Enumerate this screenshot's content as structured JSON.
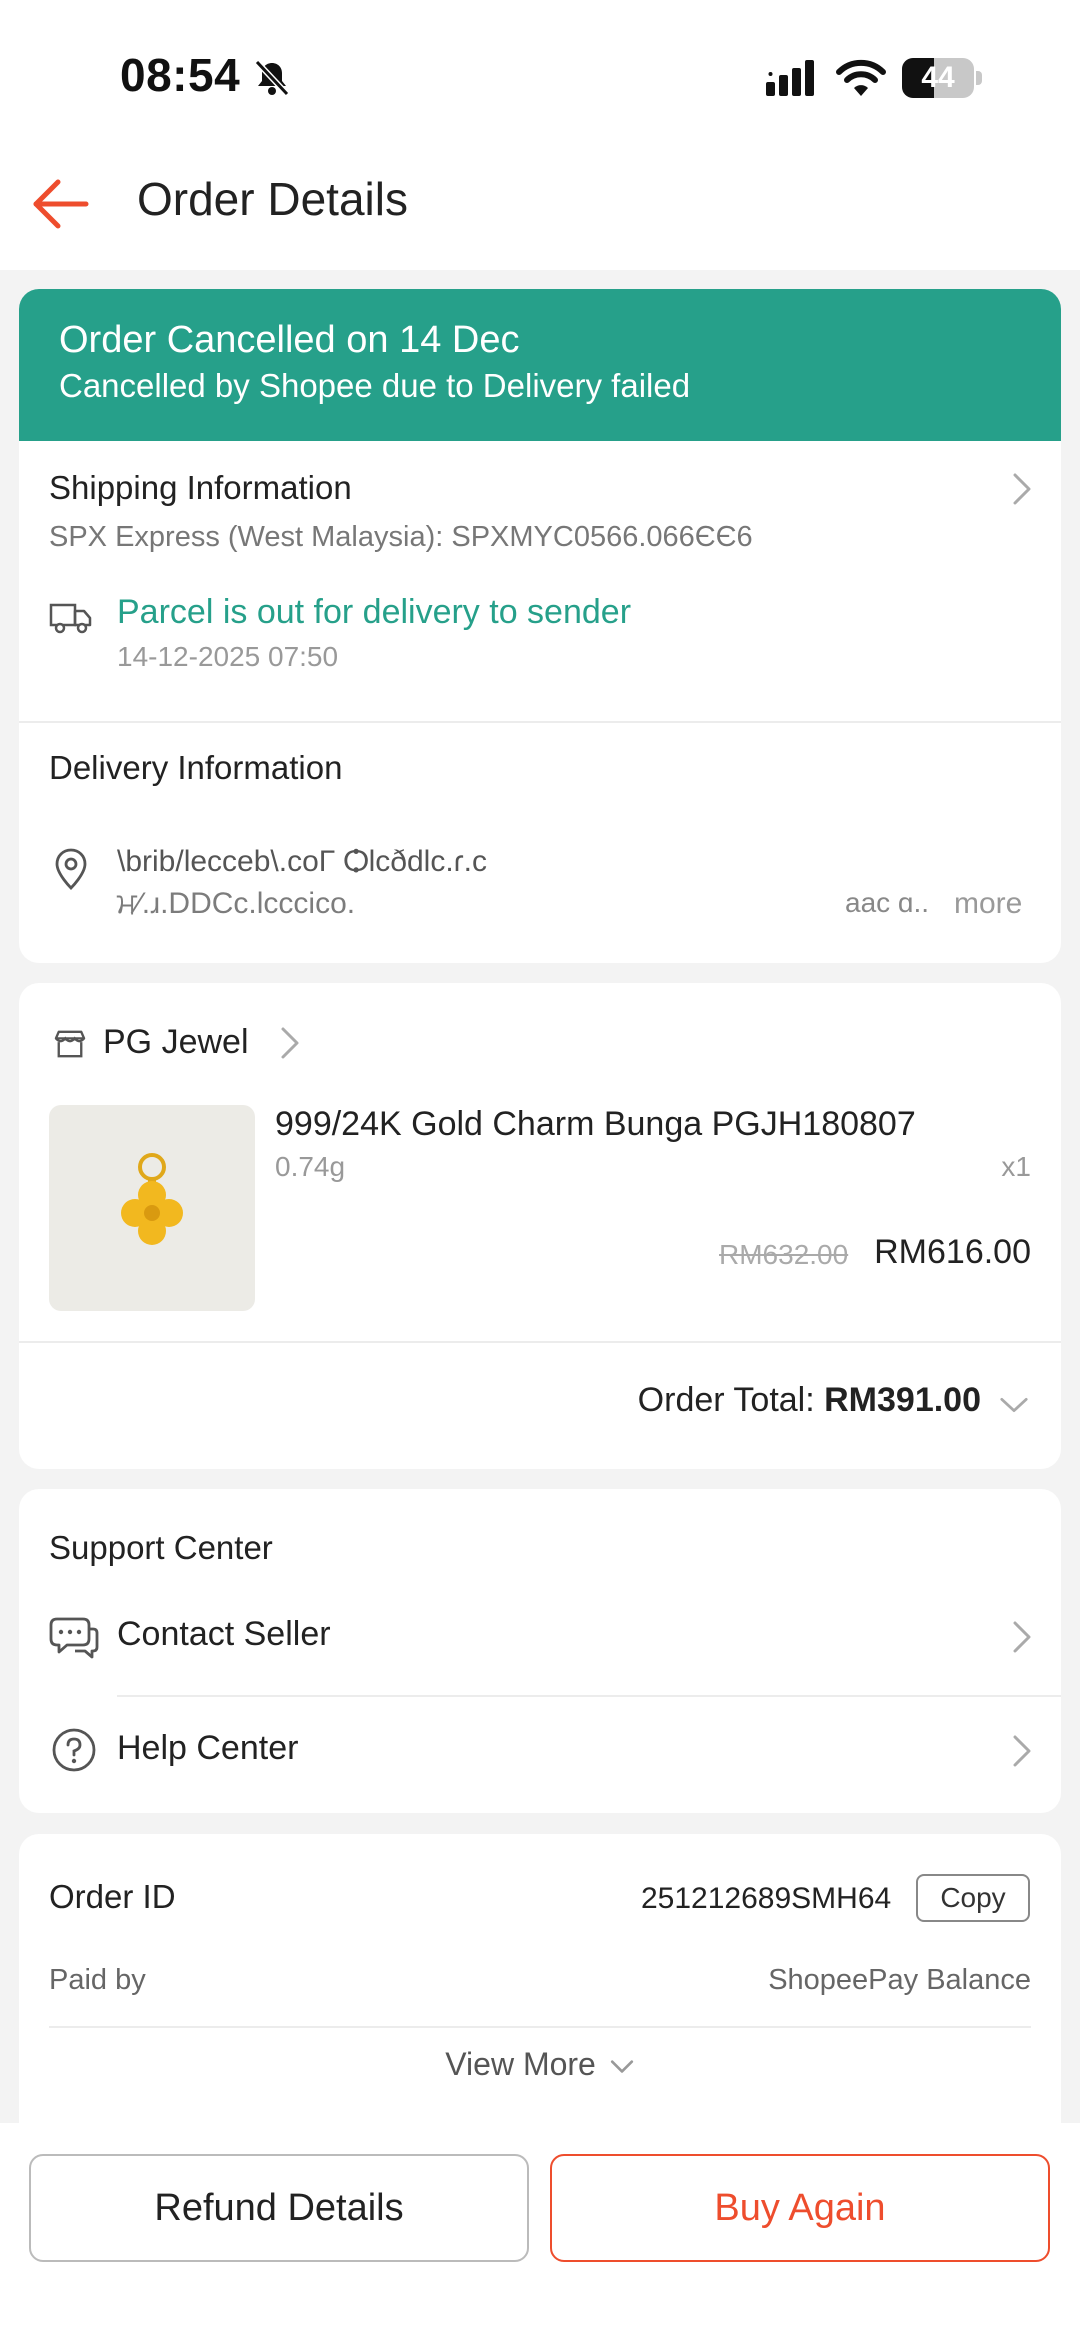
{
  "status_bar": {
    "time": "08:54",
    "battery": "44",
    "battery_level": 0.44
  },
  "header": {
    "title": "Order Details"
  },
  "banner": {
    "title": "Order Cancelled on 14 Dec",
    "subtitle": "Cancelled by Shopee due to Delivery failed",
    "color": "#26a08a"
  },
  "shipping": {
    "title": "Shipping Information",
    "carrier": "SPX Express (West Malaysia): SPXMYC0566.066ЄЄ6",
    "status": "Parcel is out for delivery to sender",
    "timestamp": "14-12-2025 07:50"
  },
  "delivery": {
    "title": "Delivery Information",
    "address_line1": "\\brib/lecceb\\.coΓ Ѻlcðdlc.ɾ.c",
    "address_line2": "ਮ⁄.ɹ.DDCc.lcccico.",
    "address_line3": "aac ɑ..",
    "more": "more"
  },
  "shop": {
    "name": "PG Jewel",
    "product": {
      "name": "999/24K Gold Charm Bunga PGJH180807",
      "variation": "0.74g",
      "quantity": "x1",
      "original_price": "RM632.00",
      "price": "RM616.00"
    },
    "order_total_label": "Order Total: ",
    "order_total": "RM391.00"
  },
  "support": {
    "title": "Support Center",
    "contact_seller": "Contact Seller",
    "help_center": "Help Center"
  },
  "order_info": {
    "order_id_label": "Order ID",
    "order_id": "251212689SMH64",
    "copy_label": "Copy",
    "paid_by_label": "Paid by",
    "paid_by": "ShopeePay Balance",
    "view_more": "View More"
  },
  "actions": {
    "refund_details": "Refund Details",
    "buy_again": "Buy Again"
  },
  "colors": {
    "accent": "#ee4d2d",
    "green": "#26a08a"
  }
}
